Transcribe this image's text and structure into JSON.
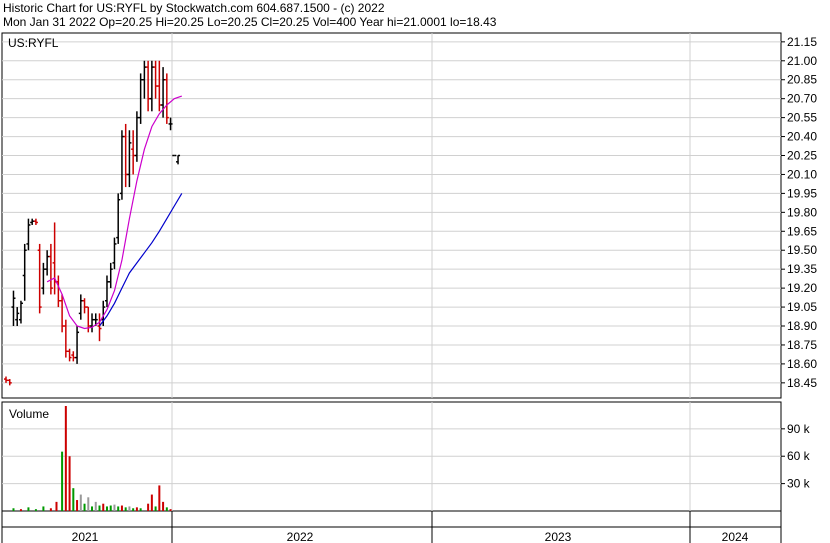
{
  "header": {
    "line1": "Historic Chart for US:RYFL by Stockwatch.com 604.687.1500 - (c) 2022",
    "line2": "Mon Jan 31 2022  Op=20.25  Hi=20.25  Lo=20.25  Cl=20.25  Vol=400  Year hi=21.0001  lo=18.43"
  },
  "chart_data": [
    {
      "type": "ohlc",
      "symbol_label": "US:RYFL",
      "price_ticks": [
        "21.15",
        "21.00",
        "20.85",
        "20.70",
        "20.55",
        "20.40",
        "20.25",
        "20.10",
        "19.95",
        "19.80",
        "19.65",
        "19.50",
        "19.35",
        "19.20",
        "19.05",
        "18.90",
        "18.75",
        "18.60",
        "18.45"
      ],
      "ylim": [
        18.33,
        21.22
      ],
      "x_categories": [
        "2021",
        "2022",
        "2023",
        "2024"
      ],
      "colors": {
        "up": "#000000",
        "down": "#cc0000",
        "ma_short": "#cc00cc",
        "ma_long": "#0000cc",
        "grid": "#d0d0d0"
      },
      "bars": [
        {
          "t": 0.0,
          "o": 18.48,
          "h": 18.5,
          "l": 18.45,
          "c": 18.47
        },
        {
          "t": 0.02,
          "o": 18.47,
          "h": 18.48,
          "l": 18.43,
          "c": 18.45
        },
        {
          "t": 0.04,
          "o": 19.05,
          "h": 19.18,
          "l": 18.9,
          "c": 19.12
        },
        {
          "t": 0.06,
          "o": 18.95,
          "h": 19.05,
          "l": 18.9,
          "c": 19.0
        },
        {
          "t": 0.08,
          "o": 18.95,
          "h": 19.1,
          "l": 18.92,
          "c": 19.08
        },
        {
          "t": 0.1,
          "o": 19.3,
          "h": 19.55,
          "l": 19.1,
          "c": 19.5
        },
        {
          "t": 0.12,
          "o": 19.55,
          "h": 19.75,
          "l": 19.5,
          "c": 19.7
        },
        {
          "t": 0.14,
          "o": 19.72,
          "h": 19.75,
          "l": 19.7,
          "c": 19.73
        },
        {
          "t": 0.16,
          "o": 19.73,
          "h": 19.75,
          "l": 19.7,
          "c": 19.72
        },
        {
          "t": 0.18,
          "o": 19.5,
          "h": 19.55,
          "l": 19.0,
          "c": 19.05
        },
        {
          "t": 0.2,
          "o": 19.2,
          "h": 19.4,
          "l": 19.15,
          "c": 19.35
        },
        {
          "t": 0.22,
          "o": 19.35,
          "h": 19.5,
          "l": 19.3,
          "c": 19.45
        },
        {
          "t": 0.24,
          "o": 19.45,
          "h": 19.55,
          "l": 19.15,
          "c": 19.2
        },
        {
          "t": 0.26,
          "o": 19.4,
          "h": 19.72,
          "l": 19.15,
          "c": 19.25
        },
        {
          "t": 0.28,
          "o": 19.25,
          "h": 19.3,
          "l": 19.05,
          "c": 19.1
        },
        {
          "t": 0.3,
          "o": 19.1,
          "h": 19.15,
          "l": 18.85,
          "c": 18.9
        },
        {
          "t": 0.32,
          "o": 18.9,
          "h": 18.95,
          "l": 18.65,
          "c": 18.7
        },
        {
          "t": 0.34,
          "o": 18.7,
          "h": 18.72,
          "l": 18.62,
          "c": 18.65
        },
        {
          "t": 0.36,
          "o": 18.67,
          "h": 18.7,
          "l": 18.62,
          "c": 18.65
        },
        {
          "t": 0.38,
          "o": 18.65,
          "h": 18.9,
          "l": 18.6,
          "c": 18.85
        },
        {
          "t": 0.4,
          "o": 19.0,
          "h": 19.15,
          "l": 18.95,
          "c": 19.1
        },
        {
          "t": 0.42,
          "o": 19.1,
          "h": 19.12,
          "l": 19.0,
          "c": 19.05
        },
        {
          "t": 0.44,
          "o": 19.05,
          "h": 19.05,
          "l": 18.85,
          "c": 18.9
        },
        {
          "t": 0.46,
          "o": 18.9,
          "h": 19.0,
          "l": 18.85,
          "c": 18.95
        },
        {
          "t": 0.48,
          "o": 18.95,
          "h": 19.0,
          "l": 18.9,
          "c": 18.95
        },
        {
          "t": 0.5,
          "o": 18.9,
          "h": 19.0,
          "l": 18.78,
          "c": 18.88
        },
        {
          "t": 0.52,
          "o": 18.95,
          "h": 19.1,
          "l": 18.9,
          "c": 19.05
        },
        {
          "t": 0.54,
          "o": 19.1,
          "h": 19.3,
          "l": 19.05,
          "c": 19.25
        },
        {
          "t": 0.56,
          "o": 19.25,
          "h": 19.4,
          "l": 19.2,
          "c": 19.35
        },
        {
          "t": 0.58,
          "o": 19.4,
          "h": 19.6,
          "l": 19.35,
          "c": 19.55
        },
        {
          "t": 0.6,
          "o": 19.6,
          "h": 19.95,
          "l": 19.55,
          "c": 19.9
        },
        {
          "t": 0.62,
          "o": 19.95,
          "h": 20.45,
          "l": 19.9,
          "c": 20.4
        },
        {
          "t": 0.64,
          "o": 20.4,
          "h": 20.5,
          "l": 20.0,
          "c": 20.1
        },
        {
          "t": 0.66,
          "o": 20.1,
          "h": 20.45,
          "l": 20.0,
          "c": 20.35
        },
        {
          "t": 0.68,
          "o": 20.3,
          "h": 20.45,
          "l": 20.1,
          "c": 20.25
        },
        {
          "t": 0.7,
          "o": 20.25,
          "h": 20.6,
          "l": 20.2,
          "c": 20.55
        },
        {
          "t": 0.72,
          "o": 20.55,
          "h": 20.9,
          "l": 20.5,
          "c": 20.85
        },
        {
          "t": 0.74,
          "o": 20.85,
          "h": 21.0,
          "l": 20.7,
          "c": 20.95
        },
        {
          "t": 0.76,
          "o": 20.95,
          "h": 21.0,
          "l": 20.6,
          "c": 20.7
        },
        {
          "t": 0.78,
          "o": 20.7,
          "h": 21.0,
          "l": 20.6,
          "c": 20.95
        },
        {
          "t": 0.8,
          "o": 20.95,
          "h": 21.0,
          "l": 20.7,
          "c": 20.8
        },
        {
          "t": 0.82,
          "o": 20.8,
          "h": 21.0,
          "l": 20.6,
          "c": 20.65
        },
        {
          "t": 0.84,
          "o": 20.65,
          "h": 20.95,
          "l": 20.55,
          "c": 20.85
        },
        {
          "t": 0.86,
          "o": 20.85,
          "h": 20.9,
          "l": 20.5,
          "c": 20.55
        },
        {
          "t": 0.88,
          "o": 20.5,
          "h": 20.55,
          "l": 20.45,
          "c": 20.5
        },
        {
          "t": 0.9,
          "o": 20.25,
          "h": 20.25,
          "l": 20.25,
          "c": 20.25
        },
        {
          "t": 0.92,
          "o": 20.2,
          "h": 20.25,
          "l": 20.18,
          "c": 20.25
        }
      ],
      "ma_short": [
        {
          "t": 0.22,
          "v": 19.25
        },
        {
          "t": 0.26,
          "v": 19.28
        },
        {
          "t": 0.3,
          "v": 19.15
        },
        {
          "t": 0.34,
          "v": 18.98
        },
        {
          "t": 0.38,
          "v": 18.9
        },
        {
          "t": 0.42,
          "v": 18.88
        },
        {
          "t": 0.46,
          "v": 18.89
        },
        {
          "t": 0.5,
          "v": 18.93
        },
        {
          "t": 0.54,
          "v": 19.03
        },
        {
          "t": 0.58,
          "v": 19.18
        },
        {
          "t": 0.62,
          "v": 19.42
        },
        {
          "t": 0.66,
          "v": 19.75
        },
        {
          "t": 0.7,
          "v": 20.05
        },
        {
          "t": 0.74,
          "v": 20.3
        },
        {
          "t": 0.78,
          "v": 20.48
        },
        {
          "t": 0.82,
          "v": 20.58
        },
        {
          "t": 0.86,
          "v": 20.65
        },
        {
          "t": 0.9,
          "v": 20.7
        },
        {
          "t": 0.94,
          "v": 20.72
        }
      ],
      "ma_long": [
        {
          "t": 0.5,
          "v": 18.9
        },
        {
          "t": 0.54,
          "v": 18.98
        },
        {
          "t": 0.58,
          "v": 19.08
        },
        {
          "t": 0.62,
          "v": 19.2
        },
        {
          "t": 0.66,
          "v": 19.32
        },
        {
          "t": 0.7,
          "v": 19.4
        },
        {
          "t": 0.74,
          "v": 19.48
        },
        {
          "t": 0.78,
          "v": 19.56
        },
        {
          "t": 0.82,
          "v": 19.65
        },
        {
          "t": 0.86,
          "v": 19.75
        },
        {
          "t": 0.9,
          "v": 19.85
        },
        {
          "t": 0.94,
          "v": 19.95
        }
      ],
      "volume_label": "Volume",
      "volume_ticks": [
        "90 k",
        "60 k",
        "30 k"
      ],
      "volume_ylim": [
        0,
        115
      ],
      "volume": [
        {
          "t": 0.04,
          "v": 3,
          "c": "#009900"
        },
        {
          "t": 0.08,
          "v": 2,
          "c": "#cc0000"
        },
        {
          "t": 0.12,
          "v": 4,
          "c": "#009900"
        },
        {
          "t": 0.16,
          "v": 2,
          "c": "#009900"
        },
        {
          "t": 0.2,
          "v": 5,
          "c": "#009900"
        },
        {
          "t": 0.24,
          "v": 3,
          "c": "#cc0000"
        },
        {
          "t": 0.27,
          "v": 10,
          "c": "#cc0000"
        },
        {
          "t": 0.3,
          "v": 65,
          "c": "#009900"
        },
        {
          "t": 0.32,
          "v": 115,
          "c": "#cc0000"
        },
        {
          "t": 0.34,
          "v": 60,
          "c": "#cc0000"
        },
        {
          "t": 0.36,
          "v": 25,
          "c": "#009900"
        },
        {
          "t": 0.38,
          "v": 12,
          "c": "#cc0000"
        },
        {
          "t": 0.4,
          "v": 18,
          "c": "#999999"
        },
        {
          "t": 0.42,
          "v": 8,
          "c": "#009900"
        },
        {
          "t": 0.44,
          "v": 15,
          "c": "#999999"
        },
        {
          "t": 0.46,
          "v": 5,
          "c": "#009900"
        },
        {
          "t": 0.48,
          "v": 10,
          "c": "#999999"
        },
        {
          "t": 0.5,
          "v": 6,
          "c": "#009900"
        },
        {
          "t": 0.52,
          "v": 8,
          "c": "#cc0000"
        },
        {
          "t": 0.54,
          "v": 5,
          "c": "#009900"
        },
        {
          "t": 0.56,
          "v": 6,
          "c": "#009900"
        },
        {
          "t": 0.58,
          "v": 7,
          "c": "#999999"
        },
        {
          "t": 0.6,
          "v": 5,
          "c": "#009900"
        },
        {
          "t": 0.62,
          "v": 6,
          "c": "#cc0000"
        },
        {
          "t": 0.64,
          "v": 4,
          "c": "#009900"
        },
        {
          "t": 0.66,
          "v": 5,
          "c": "#999999"
        },
        {
          "t": 0.68,
          "v": 3,
          "c": "#009900"
        },
        {
          "t": 0.7,
          "v": 4,
          "c": "#cc0000"
        },
        {
          "t": 0.72,
          "v": 3,
          "c": "#009900"
        },
        {
          "t": 0.76,
          "v": 8,
          "c": "#cc0000"
        },
        {
          "t": 0.78,
          "v": 18,
          "c": "#cc0000"
        },
        {
          "t": 0.8,
          "v": 5,
          "c": "#009900"
        },
        {
          "t": 0.82,
          "v": 28,
          "c": "#cc0000"
        },
        {
          "t": 0.84,
          "v": 10,
          "c": "#cc0000"
        },
        {
          "t": 0.86,
          "v": 4,
          "c": "#009900"
        },
        {
          "t": 0.88,
          "v": 2,
          "c": "#cc0000"
        }
      ]
    }
  ]
}
